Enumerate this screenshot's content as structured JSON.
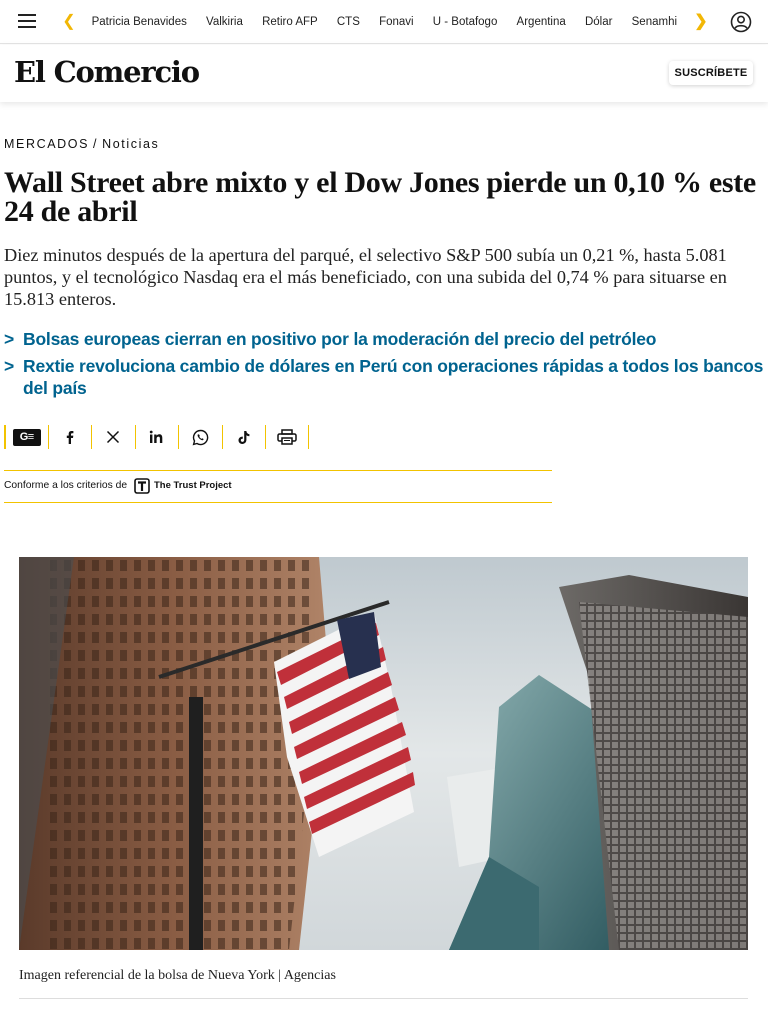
{
  "nav": {
    "items": [
      "Patricia Benavides",
      "Valkiria",
      "Retiro AFP",
      "CTS",
      "Fonavi",
      "U - Botafogo",
      "Argentina",
      "Dólar",
      "Senamhi"
    ],
    "accent": "#f2b705"
  },
  "brand": {
    "logo": "El Comercio",
    "subscribe_label": "SUSCRÍBETE"
  },
  "breadcrumb": {
    "section": "MERCADOS",
    "separator": "/",
    "subsection": "Noticias"
  },
  "article": {
    "headline": "Wall Street abre mixto y el Dow Jones pierde un 0,10 % este 24 de abril",
    "lead": "Diez minutos después de la apertura del parqué, el selectivo S&P 500 subía un 0,21 %, hasta 5.081 puntos, y el tecnológico Nasdaq era el más beneficiado, con una subida del 0,74 % para situarse en 15.813 enteros.",
    "related": [
      "Bolsas europeas cierran en positivo por la moderación del precio del petróleo",
      "Rextie revoluciona cambio de dólares en Perú con operaciones rápidas a todos los bancos del país"
    ],
    "related_color": "#00638f"
  },
  "share": {
    "buttons": [
      "google-news-icon",
      "facebook-icon",
      "x-icon",
      "linkedin-icon",
      "whatsapp-icon",
      "tiktok-icon",
      "print-icon"
    ],
    "gn_label": "G≡"
  },
  "trust": {
    "label": "Conforme a los criterios de",
    "name": "The Trust Project"
  },
  "image": {
    "caption": "Imagen referencial de la bolsa de Nueva York | Agencias"
  }
}
